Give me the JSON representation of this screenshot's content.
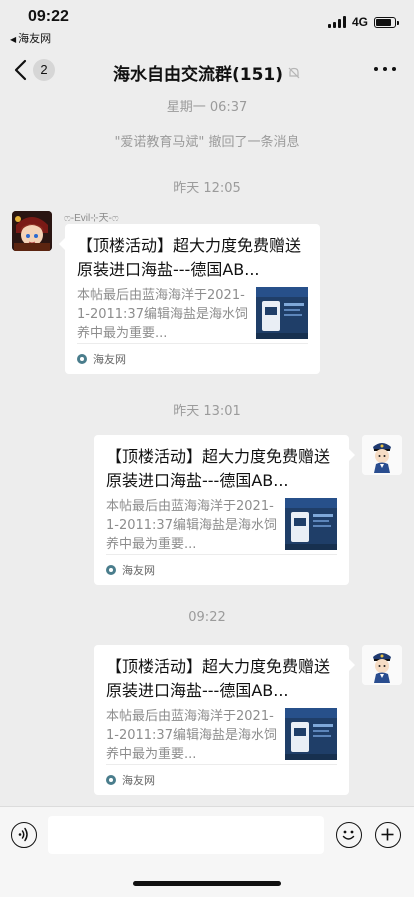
{
  "status_bar": {
    "time": "09:22",
    "back_app": "海友网",
    "network": "4G",
    "battery_level": 0.85
  },
  "nav": {
    "unread_count": "2",
    "title": "海水自由交流群(151)",
    "icons": {
      "back": "chevron-left-icon",
      "mute": "bell-muted-icon",
      "more": "more-horizontal-icon"
    }
  },
  "chat": {
    "timestamp_1": "星期一 06:37",
    "recall_notice": "\"爱诺教育马斌\" 撤回了一条消息",
    "timestamp_2": "昨天 12:05",
    "sender_name": "ෆ-Evil⊹天-ෆ",
    "timestamp_3": "昨天 13:01",
    "timestamp_4": "09:22",
    "messages": [
      {
        "title": "【顶楼活动】超大力度免费赠送原装进口海盐---德国AB...",
        "desc": "本帖最后由蓝海海洋于2021-1-2011:37编辑海盐是海水饲养中最为重要...",
        "source": "海友网"
      },
      {
        "title": "【顶楼活动】超大力度免费赠送原装进口海盐---德国AB...",
        "desc": "本帖最后由蓝海海洋于2021-1-2011:37编辑海盐是海水饲养中最为重要...",
        "source": "海友网"
      },
      {
        "title": "【顶楼活动】超大力度免费赠送原装进口海盐---德国AB...",
        "desc": "本帖最后由蓝海海洋于2021-1-2011:37编辑海盐是海水饲养中最为重要...",
        "source": "海友网"
      }
    ]
  },
  "input_bar": {
    "placeholder": "",
    "icons": {
      "voice": "voice-icon",
      "emoji": "emoji-icon",
      "plus": "plus-icon"
    }
  }
}
